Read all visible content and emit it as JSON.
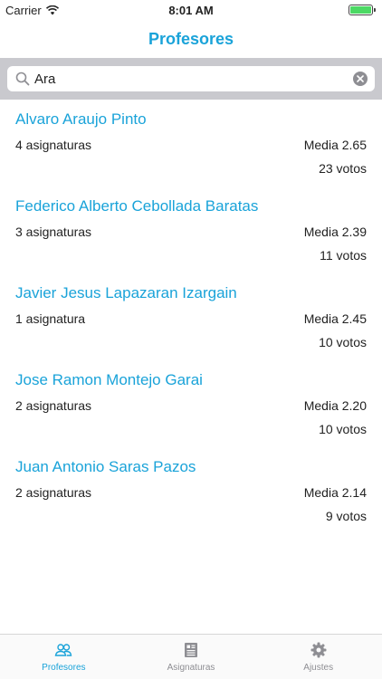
{
  "status_bar": {
    "carrier": "Carrier",
    "time": "8:01 AM"
  },
  "nav": {
    "title": "Profesores"
  },
  "search": {
    "value": "Ara"
  },
  "professors": [
    {
      "name": "Alvaro Araujo Pinto",
      "subjects": "4 asignaturas",
      "average": "Media 2.65",
      "votes": "23 votos"
    },
    {
      "name": "Federico Alberto Cebollada Baratas",
      "subjects": "3 asignaturas",
      "average": "Media 2.39",
      "votes": "11 votos"
    },
    {
      "name": "Javier Jesus Lapazaran Izargain",
      "subjects": "1 asignatura",
      "average": "Media 2.45",
      "votes": "10 votos"
    },
    {
      "name": "Jose Ramon Montejo Garai",
      "subjects": "2 asignaturas",
      "average": "Media 2.20",
      "votes": "10 votos"
    },
    {
      "name": "Juan Antonio Saras Pazos",
      "subjects": "2 asignaturas",
      "average": "Media 2.14",
      "votes": "9 votos"
    }
  ],
  "tabs": [
    {
      "label": "Profesores",
      "icon": "people-icon",
      "active": true
    },
    {
      "label": "Asignaturas",
      "icon": "book-icon",
      "active": false
    },
    {
      "label": "Ajustes",
      "icon": "gear-icon",
      "active": false
    }
  ],
  "colors": {
    "accent": "#1aa3d9",
    "search_bar_bg": "#c9c9ce",
    "battery": "#4cd964",
    "tab_inactive": "#8e8e93"
  }
}
